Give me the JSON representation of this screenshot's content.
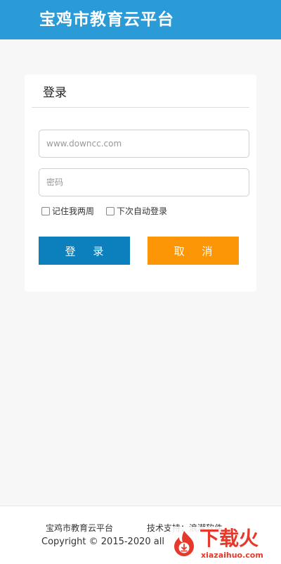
{
  "header": {
    "title": "宝鸡市教育云平台"
  },
  "login_card": {
    "title": "登录",
    "username": {
      "value": "",
      "placeholder": "www.downcc.com"
    },
    "password": {
      "value": "",
      "placeholder": "密码"
    },
    "remember_two_weeks": {
      "label": "记住我两周",
      "checked": false
    },
    "auto_login": {
      "label": "下次自动登录",
      "checked": false
    },
    "login_button_label": "登 录",
    "cancel_button_label": "取 消"
  },
  "footer": {
    "site_name": "宝鸡市教育云平台",
    "tech_support": "技术支持：浪潮软件",
    "copyright": "Copyright © 2015-2020 all"
  },
  "watermark": {
    "text": "下载火",
    "url": "xiazaihuo.com",
    "icon": "download-flame-icon"
  },
  "colors": {
    "header_bg": "#2b9bd8",
    "login_button": "#0c7fbd",
    "cancel_button": "#fd9607",
    "watermark": "#e6382b"
  }
}
